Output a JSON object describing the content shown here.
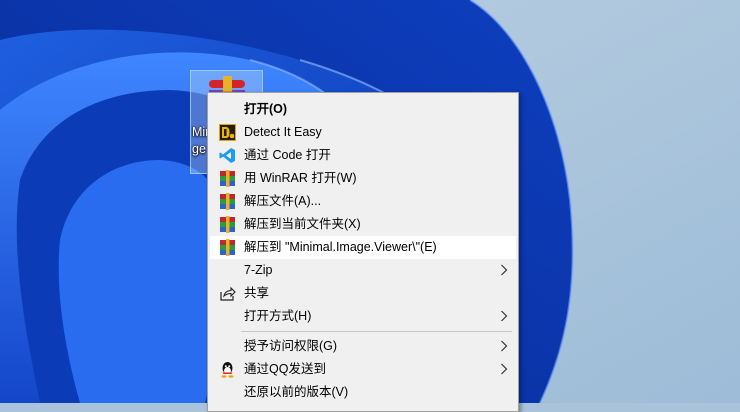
{
  "desktop_icon": {
    "label_line1": "Mini",
    "label_line2": "ge"
  },
  "menu": {
    "items": [
      {
        "label": "打开(O)"
      },
      {
        "label": "Detect It Easy"
      },
      {
        "label": "通过 Code 打开"
      },
      {
        "label": "用 WinRAR 打开(W)"
      },
      {
        "label": "解压文件(A)..."
      },
      {
        "label": "解压到当前文件夹(X)"
      },
      {
        "label": "解压到 \"Minimal.Image.Viewer\\\"(E)"
      },
      {
        "label": "7-Zip"
      },
      {
        "label": "共享"
      },
      {
        "label": "打开方式(H)"
      },
      {
        "label": "授予访问权限(G)"
      },
      {
        "label": "通过QQ发送到"
      },
      {
        "label": "还原以前的版本(V)"
      }
    ]
  },
  "colors": {
    "menu_bg": "#f0f0f0",
    "highlight": "#ffffff",
    "vscode_blue": "#1f9cf0"
  }
}
